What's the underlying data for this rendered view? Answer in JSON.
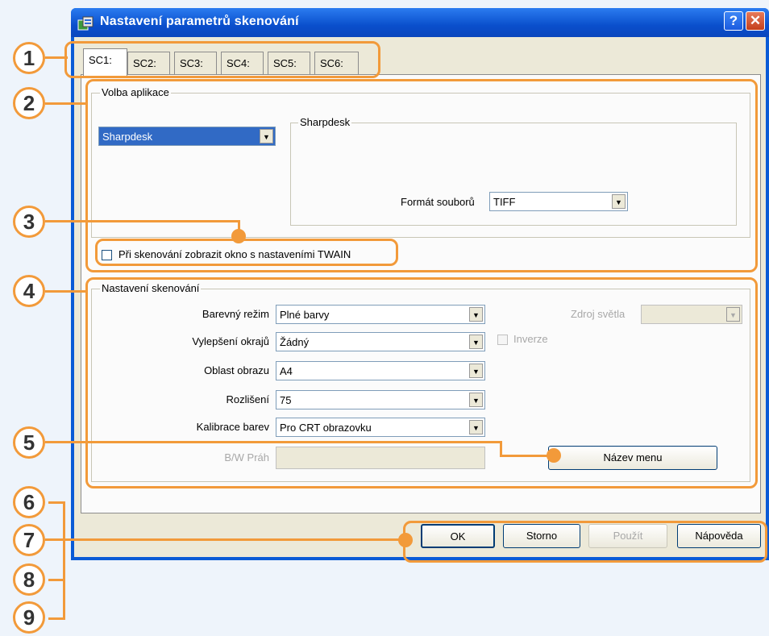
{
  "window": {
    "title": "Nastavení parametrů skenování",
    "help_glyph": "?",
    "close_glyph": "✕"
  },
  "tabs": [
    "SC1:",
    "SC2:",
    "SC3:",
    "SC4:",
    "SC5:",
    "SC6:"
  ],
  "app_group": {
    "legend": "Volba aplikace",
    "selected_app": "Sharpdesk",
    "sub_legend": "Sharpdesk",
    "format_label": "Formát souborů",
    "format_value": "TIFF",
    "twain_checkbox_label": "Při skenování zobrazit okno s nastaveními TWAIN"
  },
  "scan_group": {
    "legend": "Nastavení skenování",
    "color_mode_label": "Barevný režim",
    "color_mode_value": "Plné barvy",
    "edge_label": "Vylepšení okrajů",
    "edge_value": "Žádný",
    "area_label": "Oblast obrazu",
    "area_value": "A4",
    "resolution_label": "Rozlišení",
    "resolution_value": "75",
    "calibration_label": "Kalibrace barev",
    "calibration_value": "Pro CRT obrazovku",
    "bw_label": "B/W Práh",
    "light_source_label": "Zdroj světla",
    "inverse_label": "Inverze",
    "menu_name_button": "Název menu"
  },
  "buttons": {
    "ok": "OK",
    "cancel": "Storno",
    "apply": "Použít",
    "help": "Nápověda"
  },
  "callouts": [
    "1",
    "2",
    "3",
    "4",
    "5",
    "6",
    "7",
    "8",
    "9"
  ],
  "colors": {
    "callout": "#f29a3a",
    "titlebar": "#0a4fcc"
  },
  "arrow_glyph": "▼"
}
